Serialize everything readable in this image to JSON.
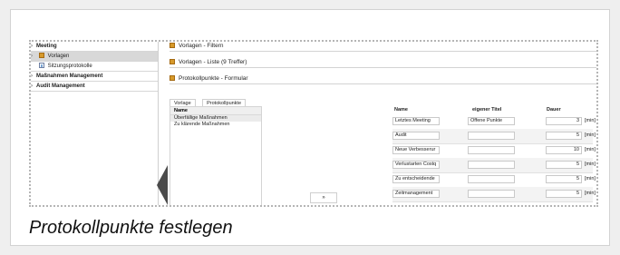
{
  "sidebar": {
    "items": [
      {
        "label": "Meeting",
        "bold": true,
        "indent": false,
        "active": false,
        "icon": ""
      },
      {
        "label": "Vorlagen",
        "bold": false,
        "indent": true,
        "active": true,
        "icon": "folder-icon"
      },
      {
        "label": "Sitzungsprotokolle",
        "bold": false,
        "indent": true,
        "active": false,
        "icon": "document-icon"
      },
      {
        "label": "Maßnahmen Management",
        "bold": true,
        "indent": false,
        "active": false,
        "icon": ""
      },
      {
        "label": "Audit Management",
        "bold": true,
        "indent": false,
        "active": false,
        "icon": ""
      }
    ]
  },
  "header": {
    "bar1": "Vorlagen - Filtern",
    "bar2": "Vorlagen - Liste (9 Treffer)",
    "bar3": "Protokollpunkte - Formular",
    "bar_icon": "folder-icon"
  },
  "tabs": [
    {
      "label": "Vorlage",
      "active": false
    },
    {
      "label": "Protokollpunkte",
      "active": true
    }
  ],
  "left_list": {
    "header": "Name",
    "rows": [
      "Überfällige Maßnahmen",
      "Zu klärende Maßnahmen"
    ]
  },
  "move_button": {
    "label": "»"
  },
  "right_grid": {
    "headers": {
      "name": "Name",
      "title": "eigener Titel",
      "duration": "Dauer"
    },
    "rows": [
      {
        "name": "Letztes Meeting",
        "title": "Offene Punkte",
        "duration": "3",
        "unit": "[min]"
      },
      {
        "name": "Audit",
        "title": "",
        "duration": "5",
        "unit": "[min]"
      },
      {
        "name": "Neue Verbesserur",
        "title": "",
        "duration": "10",
        "unit": "[min]"
      },
      {
        "name": "Verlustarten Costq",
        "title": "",
        "duration": "5",
        "unit": "[min]"
      },
      {
        "name": "Zu entscheidende",
        "title": "",
        "duration": "5",
        "unit": "[min]"
      },
      {
        "name": "Zeitmanagement",
        "title": "",
        "duration": "5",
        "unit": "[min]"
      }
    ]
  },
  "caption": "Protokollpunkte festlegen",
  "colors": {
    "folder_icon": "#d79a2b",
    "active_row": "#d8d8d8",
    "collapse_handle": "#4a4a4a"
  }
}
